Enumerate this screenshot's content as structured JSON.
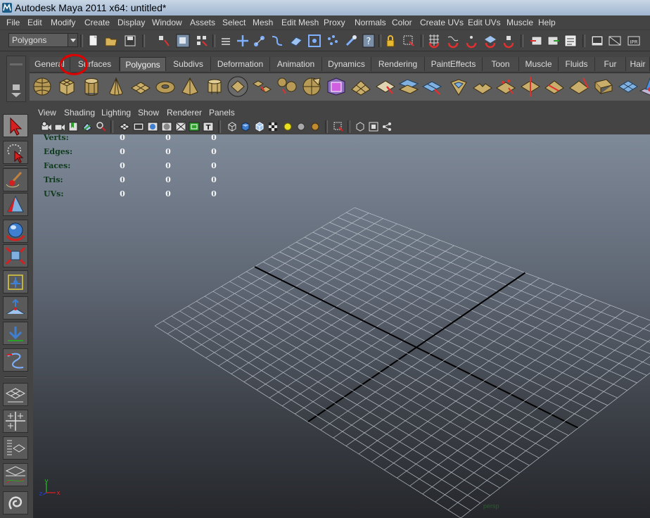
{
  "window": {
    "title": "Autodesk Maya 2011 x64: untitled*"
  },
  "menu": [
    "File",
    "Edit",
    "Modify",
    "Create",
    "Display",
    "Window",
    "Assets",
    "Select",
    "Mesh",
    "Edit Mesh",
    "Proxy",
    "Normals",
    "Color",
    "Create UVs",
    "Edit UVs",
    "Muscle",
    "Help"
  ],
  "status_line": {
    "mode": "Polygons"
  },
  "shelf": {
    "tabs": [
      "General",
      "Surfaces",
      "Polygons",
      "Subdivs",
      "Deformation",
      "Animation",
      "Dynamics",
      "Rendering",
      "PaintEffects",
      "Toon",
      "Muscle",
      "Fluids",
      "Fur",
      "Hair"
    ],
    "active_tab": "Polygons"
  },
  "panel": {
    "menu": [
      "View",
      "Shading",
      "Lighting",
      "Show",
      "Renderer",
      "Panels"
    ]
  },
  "hud": {
    "rows": [
      {
        "label": "Verts:",
        "values": [
          "0",
          "0",
          "0"
        ]
      },
      {
        "label": "Edges:",
        "values": [
          "0",
          "0",
          "0"
        ]
      },
      {
        "label": "Faces:",
        "values": [
          "0",
          "0",
          "0"
        ]
      },
      {
        "label": "Tris:",
        "values": [
          "0",
          "0",
          "0"
        ]
      },
      {
        "label": "UVs:",
        "values": [
          "0",
          "0",
          "0"
        ]
      }
    ]
  },
  "axis": {
    "x": "x",
    "y": "y",
    "z": "z"
  },
  "camera_label": "persp",
  "colors": {
    "accent_tab": "#5d5d5d",
    "annotation": "#e00000",
    "hud_label": "#0f3a1c",
    "grid_line": "#b9bfc8",
    "grid_axis": "#000000"
  }
}
